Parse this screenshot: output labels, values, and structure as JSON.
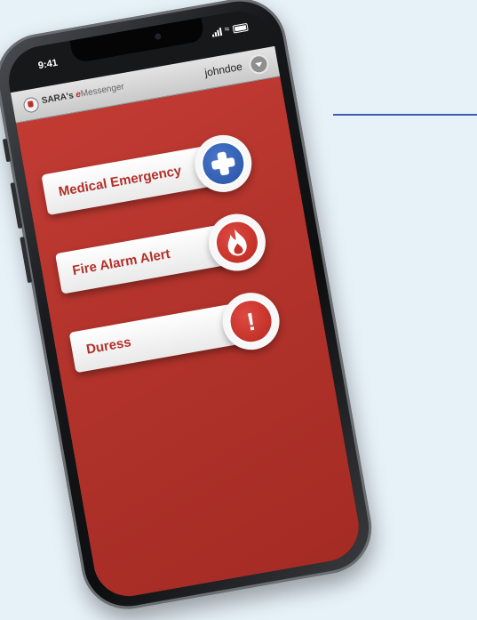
{
  "status_bar": {
    "time": "9:41"
  },
  "header": {
    "app_name_prefix": "SARA's ",
    "app_name_e": "e",
    "app_name_rest": "Messenger",
    "username": "johndoe"
  },
  "alerts": [
    {
      "label": "Medical Emergency",
      "icon": "medical-plus-icon",
      "icon_color": "#2f5aad"
    },
    {
      "label": "Fire Alarm Alert",
      "icon": "fire-icon",
      "icon_color": "#c8302a"
    },
    {
      "label": "Duress",
      "icon": "exclamation-icon",
      "icon_color": "#c8302a"
    }
  ],
  "colors": {
    "background": "#e6f1f8",
    "app_red": "#b3342c",
    "connector_line": "#3d5fb0"
  }
}
